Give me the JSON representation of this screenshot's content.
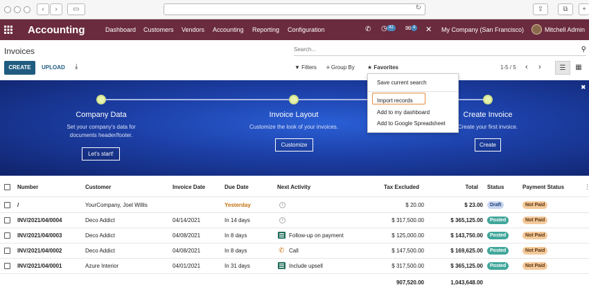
{
  "navbar": {
    "app_title": "Accounting",
    "menu": [
      "Dashboard",
      "Customers",
      "Vendors",
      "Accounting",
      "Reporting",
      "Configuration"
    ],
    "activity_count": "42",
    "message_count": "4",
    "company": "My Company (San Francisco)",
    "user": "Mitchell Admin"
  },
  "control": {
    "title": "Invoices",
    "search_placeholder": "Search...",
    "create": "CREATE",
    "upload": "UPLOAD",
    "filters": "Filters",
    "group_by": "Group By",
    "favorites": "Favorites",
    "pager": "1-5 / 5"
  },
  "favorites_menu": {
    "items": [
      "Save current search",
      "Import records",
      "Add to my dashboard",
      "Add to Google Spreadsheet"
    ]
  },
  "onboarding": {
    "steps": [
      {
        "title": "Company Data",
        "desc_line1": "Set your company's data for",
        "desc_line2": "documents header/footer.",
        "button": "Let's start!"
      },
      {
        "title": "Invoice Layout",
        "desc_line1": "Customize the look of your invoices.",
        "desc_line2": "",
        "button": "Customize"
      },
      {
        "title": "Create Invoice",
        "desc_line1": "Create your first invoice.",
        "desc_line2": "",
        "button": "Create"
      }
    ]
  },
  "table": {
    "headers": [
      "Number",
      "Customer",
      "Invoice Date",
      "Due Date",
      "Next Activity",
      "Tax Excluded",
      "Total",
      "Status",
      "Payment Status"
    ],
    "rows": [
      {
        "number": "/",
        "customer": "YourCompany, Joel Willis",
        "invoice_date": "",
        "due_date": "Yesterday",
        "activity": "",
        "activity_icon": "clock-icon",
        "tax_excluded": "$ 20.00",
        "total": "$ 23.00",
        "status": "Draft",
        "payment": "Not Paid"
      },
      {
        "number": "INV/2021/04/0004",
        "customer": "Deco Addict",
        "invoice_date": "04/14/2021",
        "due_date": "In 14 days",
        "activity": "",
        "activity_icon": "clock-icon",
        "tax_excluded": "$ 317,500.00",
        "total": "$ 365,125.00",
        "status": "Posted",
        "payment": "Not Paid"
      },
      {
        "number": "INV/2021/04/0003",
        "customer": "Deco Addict",
        "invoice_date": "04/08/2021",
        "due_date": "In 8 days",
        "activity": "Follow-up on payment",
        "activity_icon": "list-icon",
        "tax_excluded": "$ 125,000.00",
        "total": "$ 143,750.00",
        "status": "Posted",
        "payment": "Not Paid"
      },
      {
        "number": "INV/2021/04/0002",
        "customer": "Deco Addict",
        "invoice_date": "04/08/2021",
        "due_date": "In 8 days",
        "activity": "Call",
        "activity_icon": "phone-icon",
        "tax_excluded": "$ 147,500.00",
        "total": "$ 169,625.00",
        "status": "Posted",
        "payment": "Not Paid"
      },
      {
        "number": "INV/2021/04/0001",
        "customer": "Azure Interior",
        "invoice_date": "04/01/2021",
        "due_date": "In 31 days",
        "activity": "Include upsell",
        "activity_icon": "list-icon",
        "tax_excluded": "$ 317,500.00",
        "total": "$ 365,125.00",
        "status": "Posted",
        "payment": "Not Paid"
      }
    ],
    "totals": {
      "tax_excluded": "907,520.00",
      "total": "1,043,648.00"
    }
  },
  "colors": {
    "navbar": "#6b2b3f",
    "primary": "#1f5c80",
    "overdue": "#c0700f",
    "posted": "#40a69a",
    "not_paid": "#f4c99a"
  }
}
